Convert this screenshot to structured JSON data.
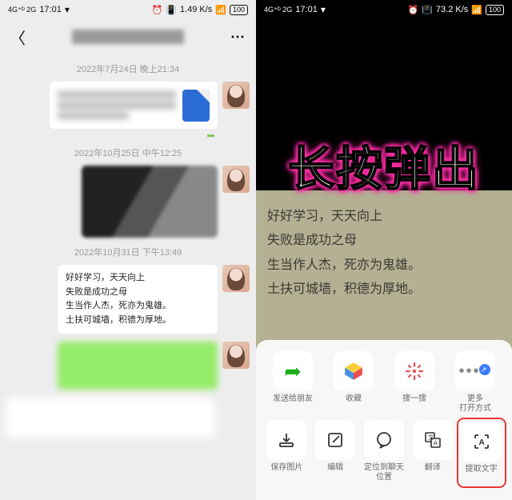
{
  "status": {
    "net": "4G⁺ᴰ 2G",
    "time": "17:01",
    "drop": "▾",
    "alarm": "⏰",
    "vib": "📳",
    "speed": "1.49 K/s",
    "speed2": "73.2 K/s",
    "wifi": "📶",
    "batt": "100"
  },
  "left": {
    "timestamps": {
      "t1": "2022年7月24日 晚上21:34",
      "t2": "2022年10月25日 中午12:25",
      "t3": "2022年10月31日 下午13:49"
    },
    "textmsg": {
      "l1": "好好学习，天天向上",
      "l2": "失败是成功之母",
      "l3": "生当作人杰，死亦为鬼雄。",
      "l4": "土扶可城墙，积德为厚地。"
    }
  },
  "right": {
    "overlay": "长按弹出",
    "page": {
      "l1": "好好学习，天天向上",
      "l2": "失败是成功之母",
      "l3": "生当作人杰，死亦为鬼雄。",
      "l4": "土扶可城墙，积德为厚地。"
    },
    "sheet": {
      "row1": {
        "a": "发送给朋友",
        "b": "收藏",
        "c": "搜一搜",
        "d": "更多\n打开方式"
      },
      "row2": {
        "a": "保存图片",
        "b": "编辑",
        "c": "定位到聊天\n位置",
        "d": "翻译",
        "e": "提取文字"
      }
    }
  }
}
